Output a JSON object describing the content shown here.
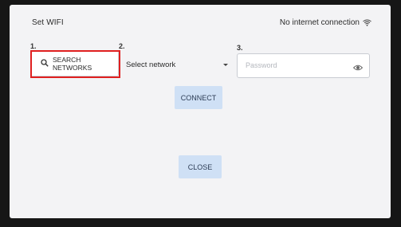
{
  "header": {
    "title": "Set WIFI",
    "status_text": "No internet connection",
    "status_icon": "wifi-icon"
  },
  "steps": {
    "step1": "1.",
    "step2": "2.",
    "step3": "3."
  },
  "search": {
    "label": "SEARCH NETWORKS",
    "icon": "search-icon"
  },
  "network_select": {
    "selected": "Select network"
  },
  "password": {
    "placeholder": "Password",
    "icon": "eye-icon"
  },
  "buttons": {
    "connect": "CONNECT",
    "close": "CLOSE"
  },
  "colors": {
    "highlight": "#e02020",
    "button_bg": "#cfe0f5",
    "screen_bg": "#f3f3f5"
  }
}
